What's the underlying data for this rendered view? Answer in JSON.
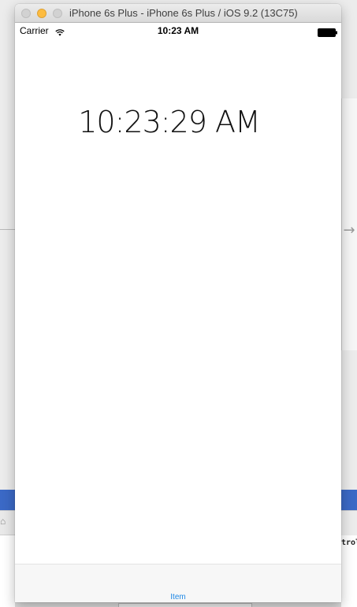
{
  "window": {
    "title": "iPhone 6s Plus - iPhone 6s Plus / iOS 9.2 (13C75)"
  },
  "status_bar": {
    "carrier": "Carrier",
    "time": "10:23 AM",
    "wifi_icon": "wifi-icon",
    "battery_icon": "battery-icon"
  },
  "main": {
    "time_display": "10:23:29 AM"
  },
  "tab_bar": {
    "items": [
      {
        "label": "Item"
      }
    ]
  },
  "background": {
    "console_text": "trol",
    "arrow_icon": "chevron-right-icon"
  },
  "colors": {
    "tab_tint": "#1e88e5",
    "selection_blue": "#3b69c6",
    "minimize_button": "#fdbc40"
  }
}
